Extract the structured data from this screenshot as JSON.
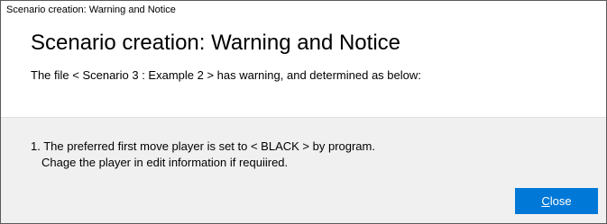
{
  "window": {
    "title": "Scenario creation: Warning and Notice"
  },
  "header": {
    "title": "Scenario creation: Warning and Notice",
    "subtitle": "The file < Scenario 3 : Example 2 > has warning, and determined as below:"
  },
  "notices": [
    {
      "line1": "1. The preferred first move player is set to < BLACK > by program.",
      "line2": "Chage the player in edit information if requiired."
    }
  ],
  "buttons": {
    "close_mnemonic": "C",
    "close_rest": "lose"
  },
  "colors": {
    "accent": "#0078d7",
    "body_background": "#f0f0f0",
    "header_background": "#ffffff"
  }
}
